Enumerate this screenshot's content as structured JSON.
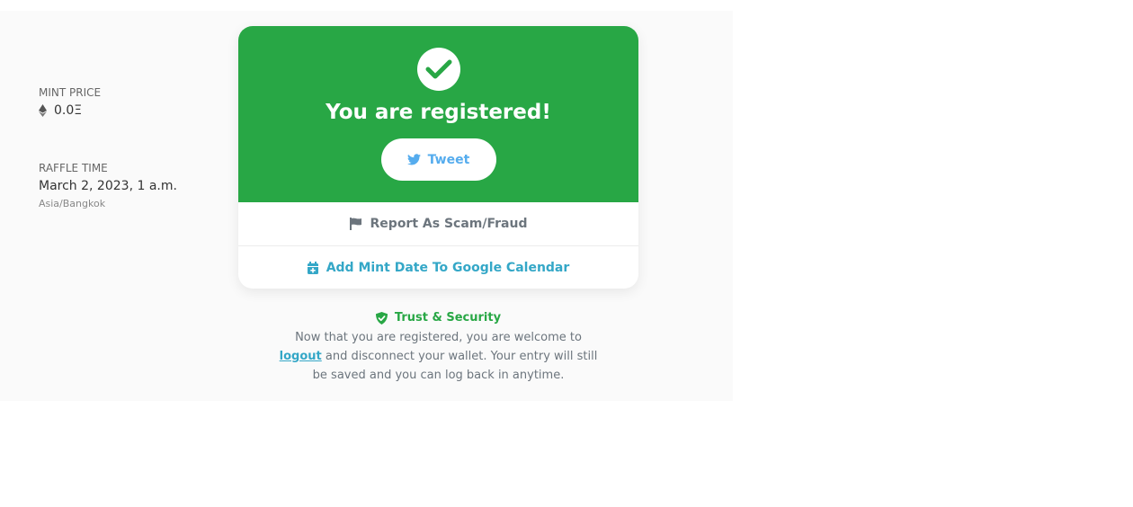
{
  "mint_price": {
    "label": "MINT PRICE",
    "value": "0.0Ξ",
    "icon": "ethereum-icon"
  },
  "raffle_time": {
    "label": "RAFFLE TIME",
    "value": "March 2, 2023, 1 a.m.",
    "timezone": "Asia/Bangkok"
  },
  "card": {
    "title": "You are registered!",
    "tweet_label": "Tweet",
    "report_label": "Report As Scam/Fraud",
    "calendar_label": "Add Mint Date To Google Calendar"
  },
  "trust": {
    "title": "Trust & Security",
    "text_before": "Now that you are registered, you are welcome to",
    "logout_label": "logout",
    "text_after": "and disconnect your wallet. Your entry will still be saved and you can log back in anytime."
  },
  "colors": {
    "success_green": "#28a745",
    "link_blue": "#34a7c7",
    "twitter_blue": "#55acee",
    "muted_gray": "#6c757d"
  }
}
